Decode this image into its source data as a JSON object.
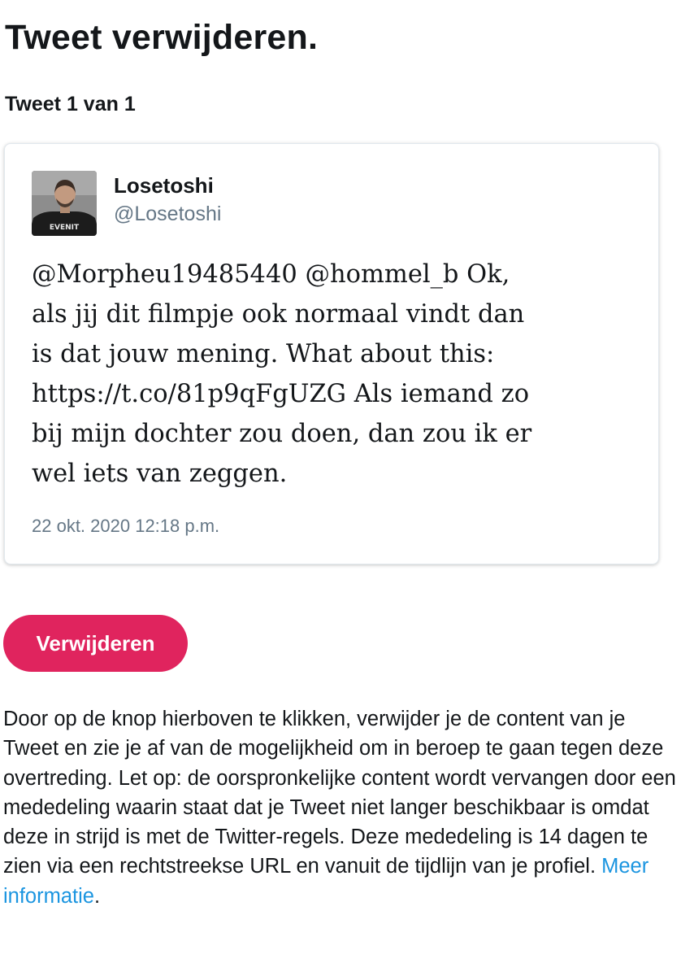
{
  "page": {
    "title": "Tweet verwijderen.",
    "counter": "Tweet 1 van 1"
  },
  "tweet": {
    "author_name": "Losetoshi",
    "author_handle": "@Losetoshi",
    "avatar_shirt_text": "EVENIT",
    "text": "@Morpheu19485440 @hommel_b Ok,\nals jij dit filmpje ook normaal vindt dan\nis dat jouw mening. What about this:\nhttps://t.co/81p9qFgUZG Als iemand zo\nbij mijn dochter zou doen, dan zou ik er\nwel iets van zeggen.",
    "timestamp": "22 okt. 2020 12:18 p.m."
  },
  "actions": {
    "delete_label": "Verwijderen"
  },
  "info": {
    "text": "Door op de knop hierboven te klikken, verwijder je de content van je Tweet en zie je af van de mogelijkheid om in beroep te gaan tegen deze overtreding. Let op: de oorspronkelijke content wordt vervangen door een mededeling waarin staat dat je Tweet niet langer beschikbaar is omdat deze in strijd is met de Twitter-regels. Deze mededeling is 14 dagen te zien via een rechtstreekse URL en vanuit de tijdlijn van je profiel.",
    "link_label": "Meer informatie",
    "end_punct": "."
  },
  "colors": {
    "accent_button": "#e0245e",
    "link": "#1b95e0",
    "muted_text": "#657786",
    "primary_text": "#14171a"
  }
}
